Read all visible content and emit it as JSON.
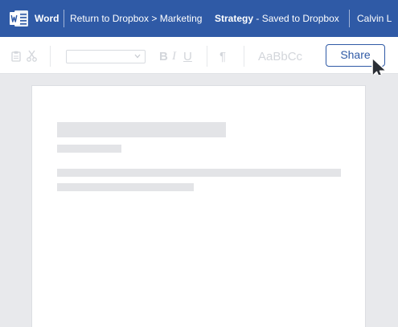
{
  "titlebar": {
    "app_name": "Word",
    "breadcrumb": "Return to Dropbox > Marketing",
    "doc_title": "Strategy",
    "doc_status": " - Saved to Dropbox",
    "user": "Calvin L",
    "background": "#2f5aa6"
  },
  "toolbar": {
    "styles_preview": "AaBbCc",
    "font_select_value": "",
    "bold_label": "B",
    "italic_label": "I",
    "underline_label": "U",
    "paragraph_mark": "¶",
    "share_label": "Share",
    "icons": [
      "paste-icon",
      "cut-icon",
      "chevron-down-icon",
      "pilcrow-icon",
      "cursor-icon"
    ]
  },
  "colors": {
    "accent": "#2f5aa6",
    "disabled": "#d3d6db",
    "placeholder": "#e3e4e7",
    "canvas": "#e8e9ec"
  }
}
